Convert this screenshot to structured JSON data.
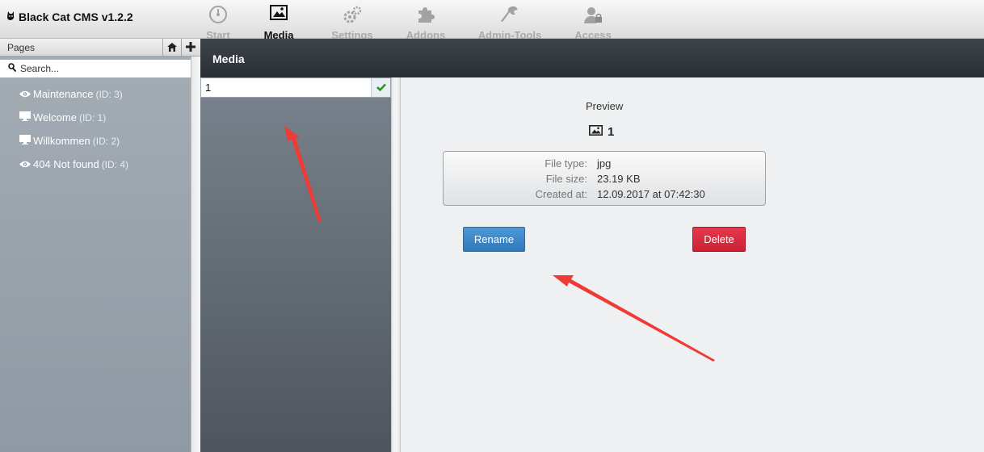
{
  "app": {
    "title": "Black Cat CMS v1.2.2"
  },
  "nav": {
    "start": "Start",
    "media": "Media",
    "settings": "Settings",
    "addons": "Addons",
    "admin_tools": "Admin-Tools",
    "access": "Access",
    "active": "Media"
  },
  "sidebar": {
    "title": "Pages",
    "search_placeholder": "Search...",
    "items": [
      {
        "label": "Maintenance",
        "id": "(ID: 3)",
        "icon": "eye-icon"
      },
      {
        "label": "Welcome",
        "id": "(ID: 1)",
        "icon": "monitor-icon"
      },
      {
        "label": "Willkommen",
        "id": "(ID: 2)",
        "icon": "monitor-icon"
      },
      {
        "label": "404 Not found",
        "id": "(ID: 4)",
        "icon": "eye-icon"
      }
    ]
  },
  "media": {
    "header": "Media",
    "filename_value": "1",
    "preview_label": "Preview",
    "preview_name": "1",
    "info": {
      "file_type_key": "File type:",
      "file_type_val": "jpg",
      "file_size_key": "File size:",
      "file_size_val": "23.19 KB",
      "created_key": "Created at:",
      "created_val": "12.09.2017 at 07:42:30"
    },
    "rename_label": "Rename",
    "delete_label": "Delete"
  },
  "colors": {
    "accent_blue": "#3584c9",
    "danger_red": "#d92b3f",
    "annotation_arrow": "#f03a36"
  }
}
